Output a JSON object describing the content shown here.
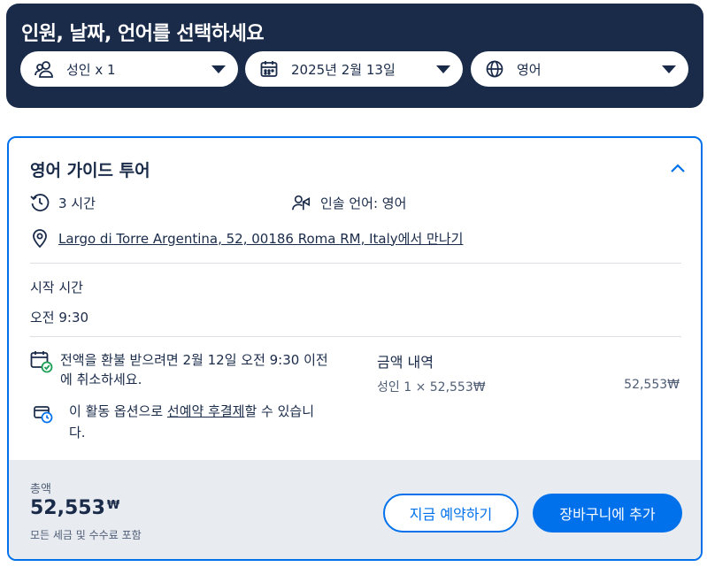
{
  "header": {
    "title": "인원, 날짜, 언어를 선택하세요",
    "participants": {
      "label": "성인 x 1",
      "icon": "people-icon"
    },
    "date": {
      "label": "2025년 2월 13일",
      "icon": "calendar-icon"
    },
    "language": {
      "label": "영어",
      "icon": "globe-icon"
    }
  },
  "option": {
    "title": "영어 가이드 투어",
    "duration": "3 시간",
    "guide_language": "인솔 언어: 영어",
    "meeting_point_link": "Largo di Torre Argentina, 52, 00186 Roma RM, Italy",
    "meeting_point_suffix": "에서 만나기",
    "start_time_label": "시작 시간",
    "start_time_value": "오전 9:30",
    "cancellation_text": "전액을 환불 받으려면 2월 12일 오전 9:30 이전에 취소하세요.",
    "rnpl_prefix": "이 활동 옵션으로 ",
    "rnpl_link": "선예약 후결제",
    "rnpl_suffix": "할 수 있습니다."
  },
  "price_breakdown": {
    "title": "금액 내역",
    "row_label": "성인 1 × 52,553₩",
    "row_value": "52,553₩"
  },
  "footer": {
    "total_label": "총액",
    "total_amount": "52,553",
    "currency": "₩",
    "total_note": "모든 세금 및 수수료 포함",
    "book_now_label": "지금 예약하기",
    "add_to_cart_label": "장바구니에 추가"
  },
  "colors": {
    "navy": "#1a2b49",
    "accent_blue": "#0071eb",
    "footer_bg": "#e8ecf1",
    "green_check": "#1a9e55"
  }
}
